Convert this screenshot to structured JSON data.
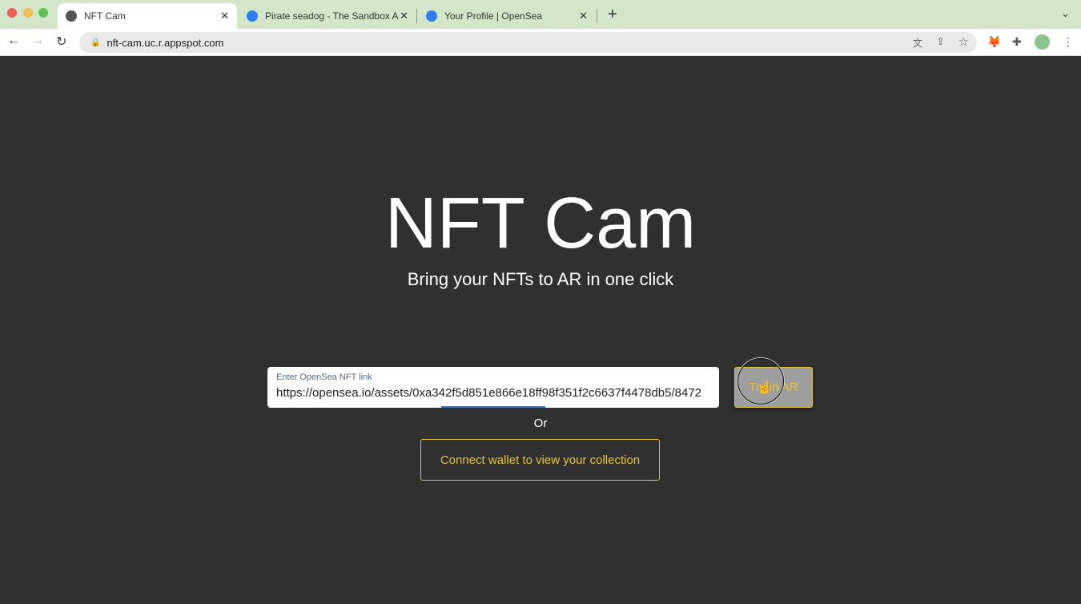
{
  "browser": {
    "tabs": [
      {
        "title": "NFT Cam",
        "active": true,
        "icon": "globe-icon"
      },
      {
        "title": "Pirate seadog - The Sandbox A",
        "active": false,
        "icon": "opensea-icon"
      },
      {
        "title": "Your Profile | OpenSea",
        "active": false,
        "icon": "opensea-icon"
      }
    ],
    "url": "nft-cam.uc.r.appspot.com"
  },
  "page": {
    "title": "NFT Cam",
    "subtitle": "Bring your NFTs to AR in one click",
    "input_label": "Enter OpenSea NFT link",
    "input_value": "https://opensea.io/assets/0xa342f5d851e866e18ff98f351f2c6637f4478db5/8472",
    "try_button": "Try in AR",
    "or_text": "Or",
    "connect_button": "Connect wallet to view your collection"
  },
  "colors": {
    "accent": "#e6c43a",
    "background": "#303030",
    "tabbar": "#d3e6c9"
  }
}
